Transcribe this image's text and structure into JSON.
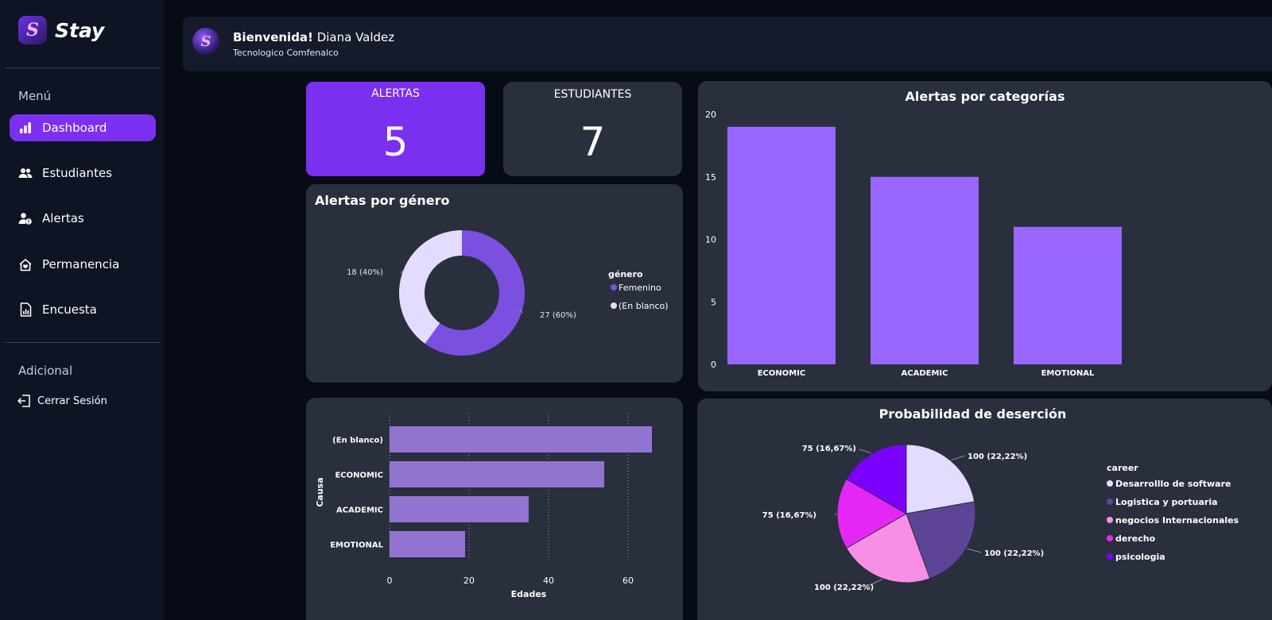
{
  "app": {
    "name": "Stay",
    "logo_glyph": "S"
  },
  "sidebar": {
    "menu_label": "Menú",
    "items": [
      {
        "label": "Dashboard",
        "icon": "bar-chart-icon",
        "active": true
      },
      {
        "label": "Estudiantes",
        "icon": "users-icon",
        "active": false
      },
      {
        "label": "Alertas",
        "icon": "user-alert-icon",
        "active": false
      },
      {
        "label": "Permanencia",
        "icon": "home-heart-icon",
        "active": false
      },
      {
        "label": "Encuesta",
        "icon": "report-icon",
        "active": false
      }
    ],
    "additional_label": "Adicional",
    "logout_label": "Cerrar Sesión"
  },
  "header": {
    "greeting_bold": "Bienvenida!",
    "user_name": "Diana Valdez",
    "institution": "Tecnologico Comfenalco"
  },
  "kpis": {
    "alerts": {
      "label": "ALERTAS",
      "value": "5"
    },
    "students": {
      "label": "ESTUDIANTES",
      "value": "7"
    }
  },
  "colors": {
    "accent": "#7b2ff0",
    "bar": "#9966ff",
    "hbar": "#9274d0",
    "card": "#2a2f3e"
  },
  "chart_data": [
    {
      "id": "gender",
      "type": "pie",
      "title": "Alertas por género",
      "legend_title": "género",
      "slices": [
        {
          "label": "Femenino",
          "value": 27,
          "text": "27 (60%)",
          "color": "#7b4fe0"
        },
        {
          "label": "(En blanco)",
          "value": 18,
          "text": "18 (40%)",
          "color": "#e4dcff"
        }
      ]
    },
    {
      "id": "categories",
      "type": "bar",
      "title": "Alertas por categorías",
      "categories": [
        "ECONOMIC",
        "ACADEMIC",
        "EMOTIONAL"
      ],
      "values": [
        19,
        15,
        11
      ],
      "ylim": [
        0,
        20
      ],
      "yticks": [
        0,
        5,
        10,
        15,
        20
      ]
    },
    {
      "id": "causes",
      "type": "bar",
      "orientation": "horizontal",
      "categories": [
        "(En blanco)",
        "ECONOMIC",
        "ACADEMIC",
        "EMOTIONAL"
      ],
      "values": [
        66,
        54,
        35,
        19
      ],
      "xlim": [
        0,
        70
      ],
      "xticks": [
        0,
        20,
        40,
        60
      ],
      "xlabel": "Edades",
      "ylabel": "Causa"
    },
    {
      "id": "dropout",
      "type": "pie",
      "title": "Probabilidad de deserción",
      "legend_title": "career",
      "slices": [
        {
          "label": "Desarrolllo de software",
          "value": 100,
          "text": "100 (22,22%)",
          "color": "#e4dcff"
        },
        {
          "label": "Logistica y portuaria",
          "value": 100,
          "text": "100 (22,22%)",
          "color": "#5e4496"
        },
        {
          "label": "negocios Internacionales",
          "value": 100,
          "text": "100 (22,22%)",
          "color": "#f78fe6"
        },
        {
          "label": "derecho",
          "value": 75,
          "text": "75 (16,67%)",
          "color": "#e527f5"
        },
        {
          "label": "psicologia",
          "value": 75,
          "text": "75 (16,67%)",
          "color": "#7c00ff"
        }
      ]
    }
  ]
}
